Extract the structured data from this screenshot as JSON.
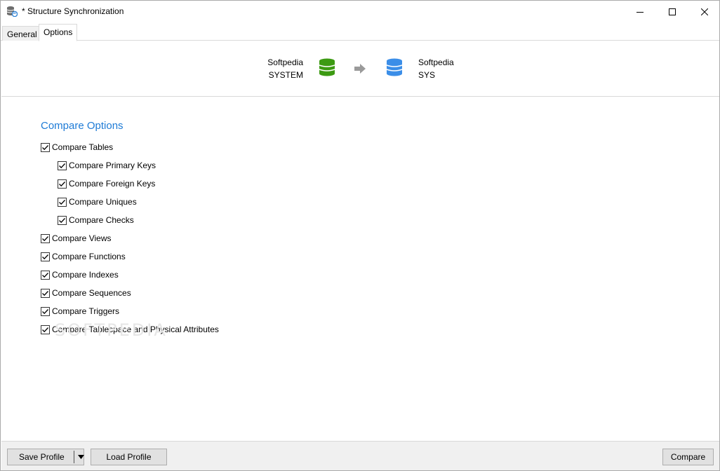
{
  "window": {
    "title": "* Structure Synchronization"
  },
  "tabs": [
    {
      "label": "General",
      "active": false
    },
    {
      "label": "Options",
      "active": true
    }
  ],
  "source": {
    "line1": "Softpedia",
    "line2": "SYSTEM",
    "icon": "database-green-icon",
    "color": "#3c9a12"
  },
  "target": {
    "line1": "Softpedia",
    "line2": "SYS",
    "icon": "database-blue-icon",
    "color": "#3b8ee8"
  },
  "compare_options": {
    "title": "Compare Options",
    "items": [
      {
        "label": "Compare Tables",
        "checked": true,
        "level": 0
      },
      {
        "label": "Compare Primary Keys",
        "checked": true,
        "level": 1
      },
      {
        "label": "Compare Foreign Keys",
        "checked": true,
        "level": 1
      },
      {
        "label": "Compare Uniques",
        "checked": true,
        "level": 1
      },
      {
        "label": "Compare Checks",
        "checked": true,
        "level": 1
      },
      {
        "label": "Compare Views",
        "checked": true,
        "level": 0
      },
      {
        "label": "Compare Functions",
        "checked": true,
        "level": 0
      },
      {
        "label": "Compare Indexes",
        "checked": true,
        "level": 0
      },
      {
        "label": "Compare Sequences",
        "checked": true,
        "level": 0
      },
      {
        "label": "Compare Triggers",
        "checked": true,
        "level": 0
      },
      {
        "label": "Compare Tablespace and Physical Attributes",
        "checked": true,
        "level": 0
      }
    ]
  },
  "watermark": "SOFTPEDIA",
  "footer": {
    "save_profile": "Save Profile",
    "load_profile": "Load Profile",
    "compare": "Compare"
  },
  "colors": {
    "accent": "#1e7bd6"
  }
}
